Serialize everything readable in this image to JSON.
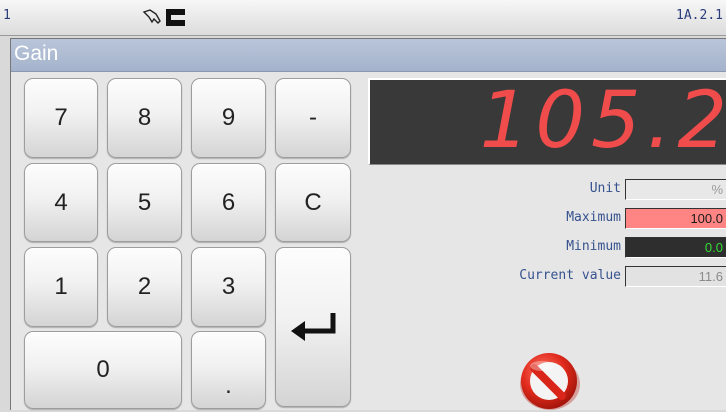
{
  "status": {
    "id": "1",
    "version": "1A.2.1",
    "icons": [
      "hand-icon",
      "connector-icon"
    ]
  },
  "dialog": {
    "title": "Gain"
  },
  "keypad": {
    "k7": "7",
    "k8": "8",
    "k9": "9",
    "minus": "-",
    "k4": "4",
    "k5": "5",
    "k6": "6",
    "clear": "C",
    "k1": "1",
    "k2": "2",
    "k3": "3",
    "k0": "0",
    "dot": ".",
    "enter_icon": "enter-arrow-icon"
  },
  "display": {
    "value": "105.2",
    "color": "#f04c4c"
  },
  "properties": {
    "unit_label": "Unit",
    "unit_value": "%",
    "max_label": "Maximum",
    "max_value": "100.0",
    "min_label": "Minimum",
    "min_value": "0.0",
    "current_label": "Current value",
    "current_value": "11.6"
  },
  "actions": {
    "cancel_icon": "cancel-icon"
  },
  "colors": {
    "title_bar": "#a4b3cc",
    "max_bg": "#ff8585",
    "min_bg": "#2e2e2e",
    "min_text": "#33dd33"
  }
}
